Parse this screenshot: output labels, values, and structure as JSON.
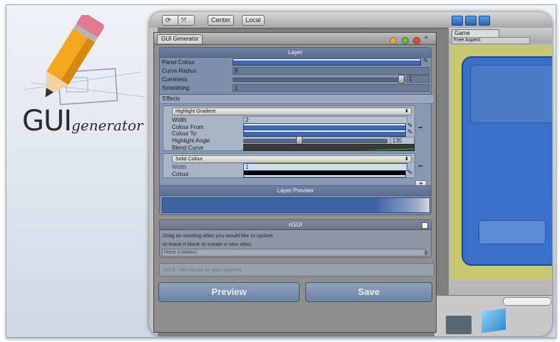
{
  "logo": {
    "text_big": "GUI",
    "text_small": "generator"
  },
  "editor": {
    "toolbar": {
      "pivot_label": "Center",
      "space_label": "Local"
    },
    "game": {
      "tab_label": "Game",
      "aspect_label": "Free Aspect"
    }
  },
  "window": {
    "tab_label": "GUI Generator",
    "layer": {
      "header": "Layer",
      "panel_colour_label": "Panel Colour",
      "curve_radius_label": "Curve Radius",
      "curve_radius_value": "8",
      "curviness_label": "Curviness",
      "curviness_value": "1",
      "smoothing_label": "Smoothing",
      "smoothing_value": "1"
    },
    "effects": {
      "header": "Effects",
      "effect1": {
        "type": "Highlight Gradient",
        "width_label": "Width",
        "width_value": "2",
        "colour_from_label": "Colour From",
        "colour_to_label": "Colour To",
        "highlight_angle_label": "Highlight Angle",
        "highlight_angle_value": "135",
        "blend_curve_label": "Blend Curve"
      },
      "effect2": {
        "type": "Solid Colour",
        "width_label": "Width",
        "width_value": "1",
        "colour_label": "Colour"
      },
      "remove_label": "–",
      "add_label": "+"
    },
    "preview": {
      "header": "Layer Preview"
    },
    "ngui": {
      "header": "nGUI",
      "line1": "Drag an existing atlas you would like to update",
      "line2": "or leave it blank to create a new atlas.",
      "field_value": "None (UIAtlas)"
    },
    "not_found_text": "nGUI - Not found on your system",
    "preview_button": "Preview",
    "save_button": "Save"
  },
  "colors": {
    "panel_blue": "#3e69b4",
    "section_header": "#5b6f90",
    "button": "#7f93b2"
  }
}
